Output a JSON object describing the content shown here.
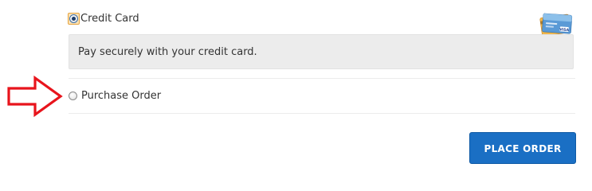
{
  "payment_methods": [
    {
      "label": "Credit Card",
      "selected": true,
      "description": "Pay securely with your credit card.",
      "icon": "credit-card-visa-icon"
    },
    {
      "label": "Purchase Order",
      "selected": false
    }
  ],
  "annotation": {
    "icon": "red-arrow-pointing-right",
    "color": "#e8141c"
  },
  "actions": {
    "place_order_label": "PLACE ORDER",
    "button_color": "#1a6fc4"
  }
}
